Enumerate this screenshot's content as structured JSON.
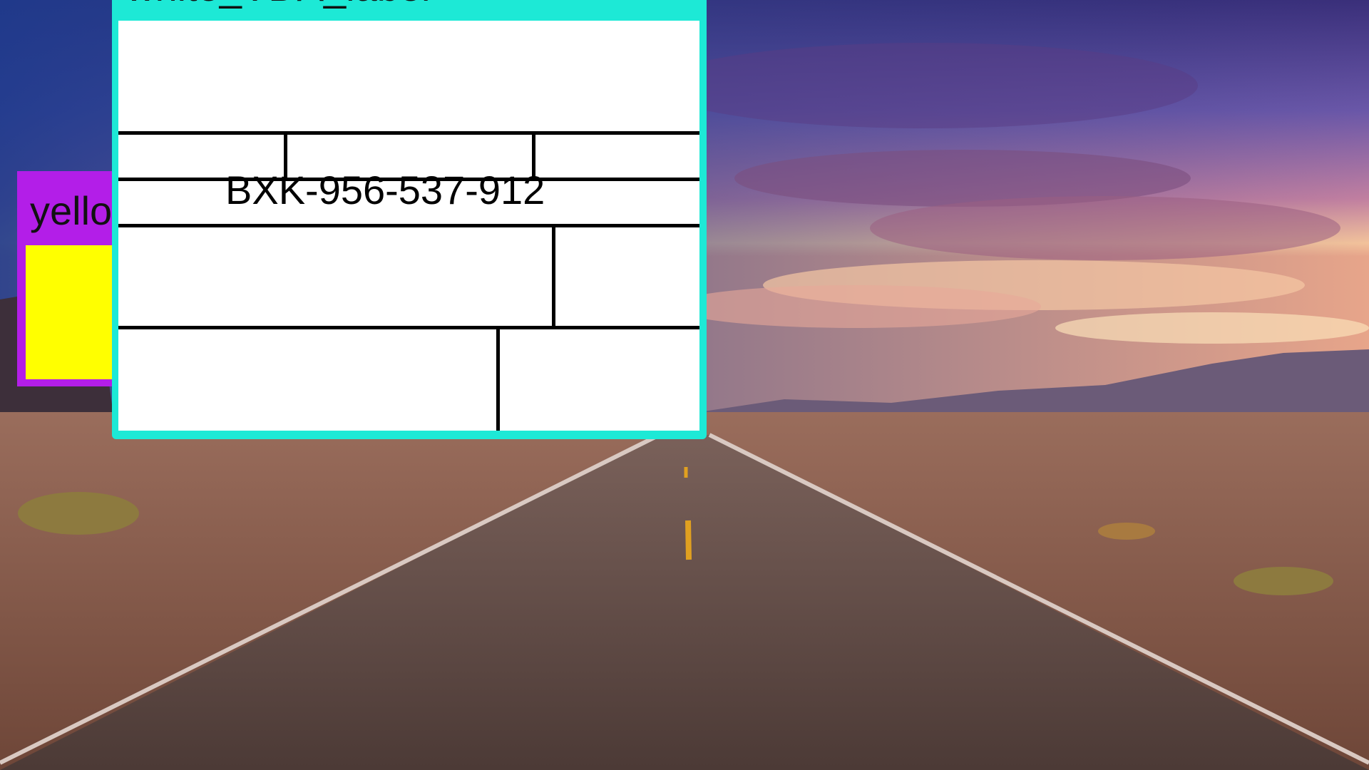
{
  "yellow_box": {
    "label": "yello",
    "frame_color": "#b31ee8",
    "fill_color": "#ffff00"
  },
  "white_label": {
    "title": "white_VDA_label",
    "frame_color": "#1de9d6",
    "code": "BXK-956-537-912"
  },
  "background": {
    "scene": "desert-road-sunset"
  }
}
